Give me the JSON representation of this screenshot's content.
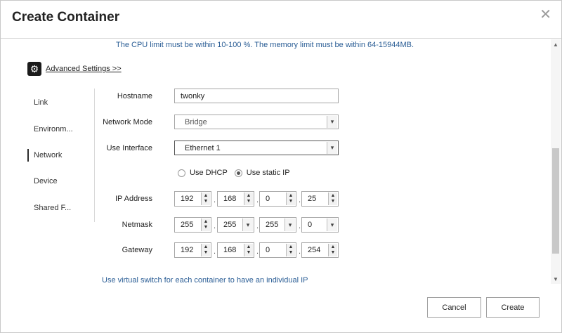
{
  "dialog": {
    "title": "Create Container",
    "close_glyph": "✕"
  },
  "limit_note": "The CPU limit must be within 10-100 %. The memory limit must be within 64-15944MB.",
  "advanced": {
    "icon": "gear-icon",
    "label": "Advanced Settings >>"
  },
  "sidebar": {
    "items": [
      {
        "label": "Link"
      },
      {
        "label": "Environm..."
      },
      {
        "label": "Network",
        "active": true
      },
      {
        "label": "Device"
      },
      {
        "label": "Shared F..."
      }
    ]
  },
  "form": {
    "hostname_label": "Hostname",
    "hostname_value": "twonky",
    "network_mode_label": "Network Mode",
    "network_mode_value": "Bridge",
    "use_interface_label": "Use Interface",
    "use_interface_value": "Ethernet 1",
    "dhcp_label": "Use DHCP",
    "static_label": "Use static IP",
    "selected_ip_mode": "static",
    "ip_label": "IP Address",
    "ip": [
      "192",
      "168",
      "0",
      "25"
    ],
    "netmask_label": "Netmask",
    "netmask": [
      "255",
      "255",
      "255",
      "0"
    ],
    "gateway_label": "Gateway",
    "gateway": [
      "192",
      "168",
      "0",
      "254"
    ],
    "separator": "."
  },
  "virtual_switch_note": "Use virtual switch for each container to have an individual IP",
  "buttons": {
    "cancel": "Cancel",
    "create": "Create"
  }
}
